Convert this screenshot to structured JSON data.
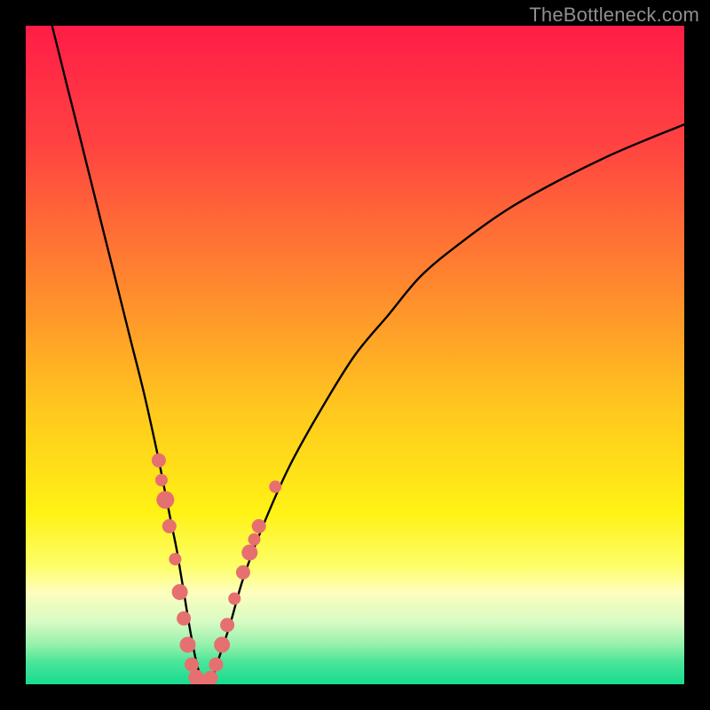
{
  "watermark": "TheBottleneck.com",
  "colors": {
    "frame": "#000000",
    "curve": "#000000",
    "dot_fill": "#e6706f",
    "dot_stroke": "#c75451",
    "gradient_stops": [
      {
        "offset": 0.0,
        "color": "#ff1d47"
      },
      {
        "offset": 0.18,
        "color": "#ff4341"
      },
      {
        "offset": 0.4,
        "color": "#ff8a2e"
      },
      {
        "offset": 0.58,
        "color": "#ffc71e"
      },
      {
        "offset": 0.74,
        "color": "#fff215"
      },
      {
        "offset": 0.82,
        "color": "#fdfe68"
      },
      {
        "offset": 0.86,
        "color": "#fefebd"
      },
      {
        "offset": 0.905,
        "color": "#d8fbc3"
      },
      {
        "offset": 0.94,
        "color": "#95f1ac"
      },
      {
        "offset": 0.965,
        "color": "#4ce69a"
      },
      {
        "offset": 1.0,
        "color": "#18db90"
      }
    ]
  },
  "chart_data": {
    "type": "line",
    "title": "",
    "xlabel": "",
    "ylabel": "",
    "xlim": [
      0,
      100
    ],
    "ylim": [
      0,
      100
    ],
    "series": [
      {
        "name": "bottleneck-curve",
        "x": [
          4,
          6,
          8,
          10,
          12,
          14,
          16,
          18,
          20,
          21,
          22,
          23,
          24,
          25,
          26,
          27,
          28,
          29,
          31,
          33,
          36,
          40,
          45,
          50,
          55,
          60,
          66,
          73,
          80,
          88,
          95,
          100
        ],
        "y": [
          100,
          92,
          84,
          76,
          68,
          60,
          52,
          44,
          35,
          30,
          25,
          20,
          14,
          8,
          3,
          0,
          0,
          3,
          9,
          16,
          24,
          33,
          42,
          50,
          56,
          62,
          67,
          72,
          76,
          80,
          83,
          85
        ]
      }
    ],
    "scatter_points": {
      "name": "highlight-dots",
      "points": [
        {
          "x": 20.2,
          "y": 34,
          "r": 8
        },
        {
          "x": 20.6,
          "y": 31,
          "r": 7
        },
        {
          "x": 21.2,
          "y": 28,
          "r": 10
        },
        {
          "x": 21.8,
          "y": 24,
          "r": 8
        },
        {
          "x": 22.7,
          "y": 19,
          "r": 7
        },
        {
          "x": 23.4,
          "y": 14,
          "r": 9
        },
        {
          "x": 24.0,
          "y": 10,
          "r": 8
        },
        {
          "x": 24.6,
          "y": 6,
          "r": 9
        },
        {
          "x": 25.2,
          "y": 3,
          "r": 8
        },
        {
          "x": 25.9,
          "y": 1,
          "r": 9
        },
        {
          "x": 26.6,
          "y": 0,
          "r": 8
        },
        {
          "x": 27.4,
          "y": 0,
          "r": 9
        },
        {
          "x": 28.1,
          "y": 1,
          "r": 8
        },
        {
          "x": 28.9,
          "y": 3,
          "r": 8
        },
        {
          "x": 29.8,
          "y": 6,
          "r": 9
        },
        {
          "x": 30.6,
          "y": 9,
          "r": 8
        },
        {
          "x": 31.7,
          "y": 13,
          "r": 7
        },
        {
          "x": 33.0,
          "y": 17,
          "r": 8
        },
        {
          "x": 34.0,
          "y": 20,
          "r": 9
        },
        {
          "x": 34.7,
          "y": 22,
          "r": 7
        },
        {
          "x": 35.4,
          "y": 24,
          "r": 8
        },
        {
          "x": 37.9,
          "y": 30,
          "r": 7
        }
      ]
    }
  }
}
